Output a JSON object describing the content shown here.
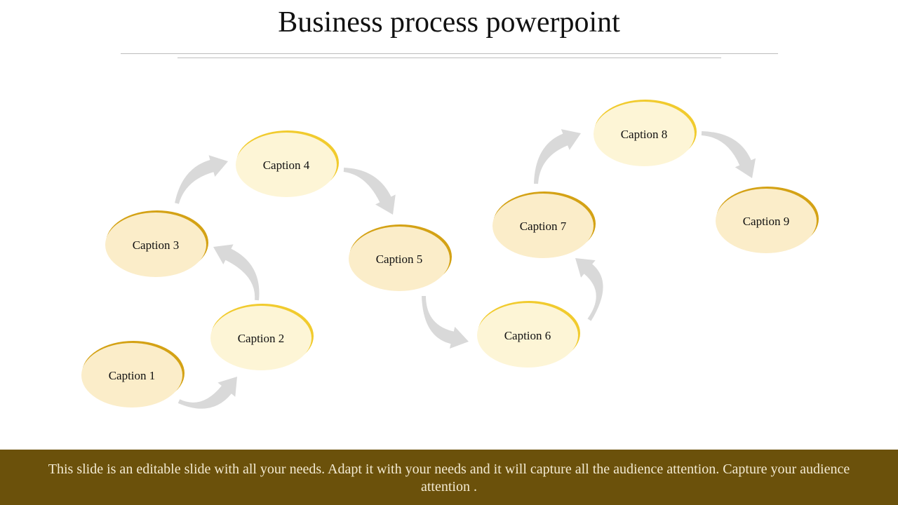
{
  "title": "Business process powerpoint",
  "colors": {
    "ellipse_fill_warm": "#fbedc9",
    "ellipse_fill_light": "#fdf5d6",
    "rim_dark_gold": "#d4a215",
    "rim_bright_gold": "#f1cb2e",
    "arrow": "#d9d9d9",
    "footer_bg": "#6b510b",
    "footer_text": "#f3ead2"
  },
  "steps": [
    {
      "label": "Caption 1",
      "rim": "dark"
    },
    {
      "label": "Caption 2",
      "rim": "bright"
    },
    {
      "label": "Caption 3",
      "rim": "dark"
    },
    {
      "label": "Caption 4",
      "rim": "bright"
    },
    {
      "label": "Caption 5",
      "rim": "dark"
    },
    {
      "label": "Caption 6",
      "rim": "bright"
    },
    {
      "label": "Caption 7",
      "rim": "dark"
    },
    {
      "label": "Caption 8",
      "rim": "bright"
    },
    {
      "label": "Caption 9",
      "rim": "dark"
    }
  ],
  "footer": {
    "text": "This slide is an editable slide with all your needs. Adapt it with your needs and it will capture all the audience attention. Capture your audience attention ."
  }
}
